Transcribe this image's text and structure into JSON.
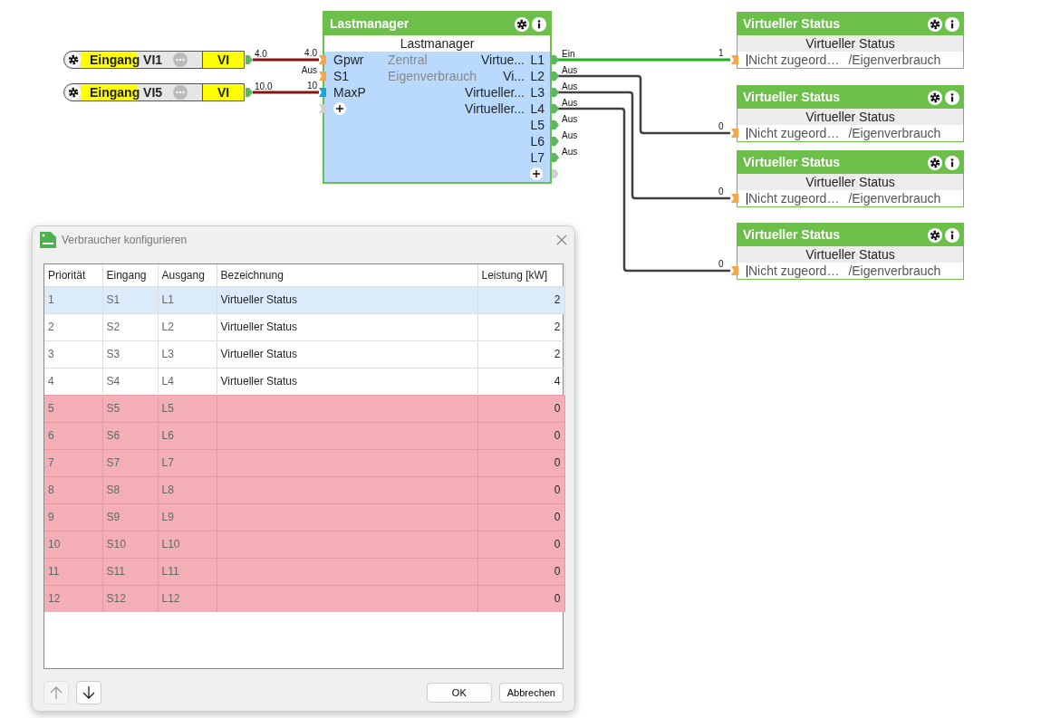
{
  "input_blocks": [
    {
      "label": "Eingang VI1",
      "type": "VI",
      "output_value": "4.0"
    },
    {
      "label": "Eingang VI5",
      "type": "VI",
      "output_value": "10.0"
    }
  ],
  "lastmanager": {
    "title": "Lastmanager",
    "subtitle": "Lastmanager",
    "inputs": [
      {
        "label": "Gpwr",
        "info": "Zentral",
        "value": "4.0",
        "color": "#f5a64a"
      },
      {
        "label": "S1",
        "info": "Eigenverbrauch",
        "value": "Aus",
        "color": "#f5a64a"
      },
      {
        "label": "MaxP",
        "value": "10",
        "color": "#1aa3e0"
      }
    ],
    "outputs": [
      {
        "label": "L1",
        "text": "Virtue...",
        "value": "Ein"
      },
      {
        "label": "L2",
        "text": "Vi...",
        "value": "Aus"
      },
      {
        "label": "L3",
        "text": "Virtueller...",
        "value": "Aus"
      },
      {
        "label": "L4",
        "text": "Virtueller...",
        "value": "Aus"
      },
      {
        "label": "L5",
        "value": "Aus"
      },
      {
        "label": "L6",
        "value": "Aus"
      },
      {
        "label": "L7",
        "value": "Aus"
      }
    ]
  },
  "status_blocks": [
    {
      "title": "Virtueller Status",
      "subtitle": "Virtueller Status",
      "input_value": "1",
      "input_active": true,
      "assignment": "Nicht zugeord…",
      "path": "/Eigenverbrauch"
    },
    {
      "title": "Virtueller Status",
      "subtitle": "Virtueller Status",
      "input_value": "0",
      "input_active": false,
      "assignment": "Nicht zugeord…",
      "path": "/Eigenverbrauch"
    },
    {
      "title": "Virtueller Status",
      "subtitle": "Virtueller Status",
      "input_value": "0",
      "input_active": false,
      "assignment": "Nicht zugeord…",
      "path": "/Eigenverbrauch"
    },
    {
      "title": "Virtueller Status",
      "subtitle": "Virtueller Status",
      "input_value": "0",
      "input_active": false,
      "assignment": "Nicht zugeord…",
      "path": "/Eigenverbrauch"
    }
  ],
  "dialog": {
    "title": "Verbraucher konfigurieren",
    "table": {
      "columns": [
        "Priorität",
        "Eingang",
        "Ausgang",
        "Bezeichnung",
        "Leistung [kW]"
      ],
      "rows": [
        {
          "cells": [
            "1",
            "S1",
            "L1",
            "Virtueller Status",
            "2"
          ],
          "selected": true,
          "unassigned": false
        },
        {
          "cells": [
            "2",
            "S2",
            "L2",
            "Virtueller Status",
            "2"
          ],
          "selected": false,
          "unassigned": false
        },
        {
          "cells": [
            "3",
            "S3",
            "L3",
            "Virtueller Status",
            "2"
          ],
          "selected": false,
          "unassigned": false
        },
        {
          "cells": [
            "4",
            "S4",
            "L4",
            "Virtueller Status",
            "4"
          ],
          "selected": false,
          "unassigned": false
        },
        {
          "cells": [
            "5",
            "S5",
            "L5",
            "",
            "0"
          ],
          "selected": false,
          "unassigned": true
        },
        {
          "cells": [
            "6",
            "S6",
            "L6",
            "",
            "0"
          ],
          "selected": false,
          "unassigned": true
        },
        {
          "cells": [
            "7",
            "S7",
            "L7",
            "",
            "0"
          ],
          "selected": false,
          "unassigned": true
        },
        {
          "cells": [
            "8",
            "S8",
            "L8",
            "",
            "0"
          ],
          "selected": false,
          "unassigned": true
        },
        {
          "cells": [
            "9",
            "S9",
            "L9",
            "",
            "0"
          ],
          "selected": false,
          "unassigned": true
        },
        {
          "cells": [
            "10",
            "S10",
            "L10",
            "",
            "0"
          ],
          "selected": false,
          "unassigned": true
        },
        {
          "cells": [
            "11",
            "S11",
            "L11",
            "",
            "0"
          ],
          "selected": false,
          "unassigned": true
        },
        {
          "cells": [
            "12",
            "S12",
            "L12",
            "",
            "0"
          ],
          "selected": false,
          "unassigned": true
        }
      ]
    },
    "move_up": {
      "disabled": true
    },
    "move_down": {
      "disabled": false
    },
    "buttons": [
      "OK",
      "Abbrechen"
    ]
  }
}
